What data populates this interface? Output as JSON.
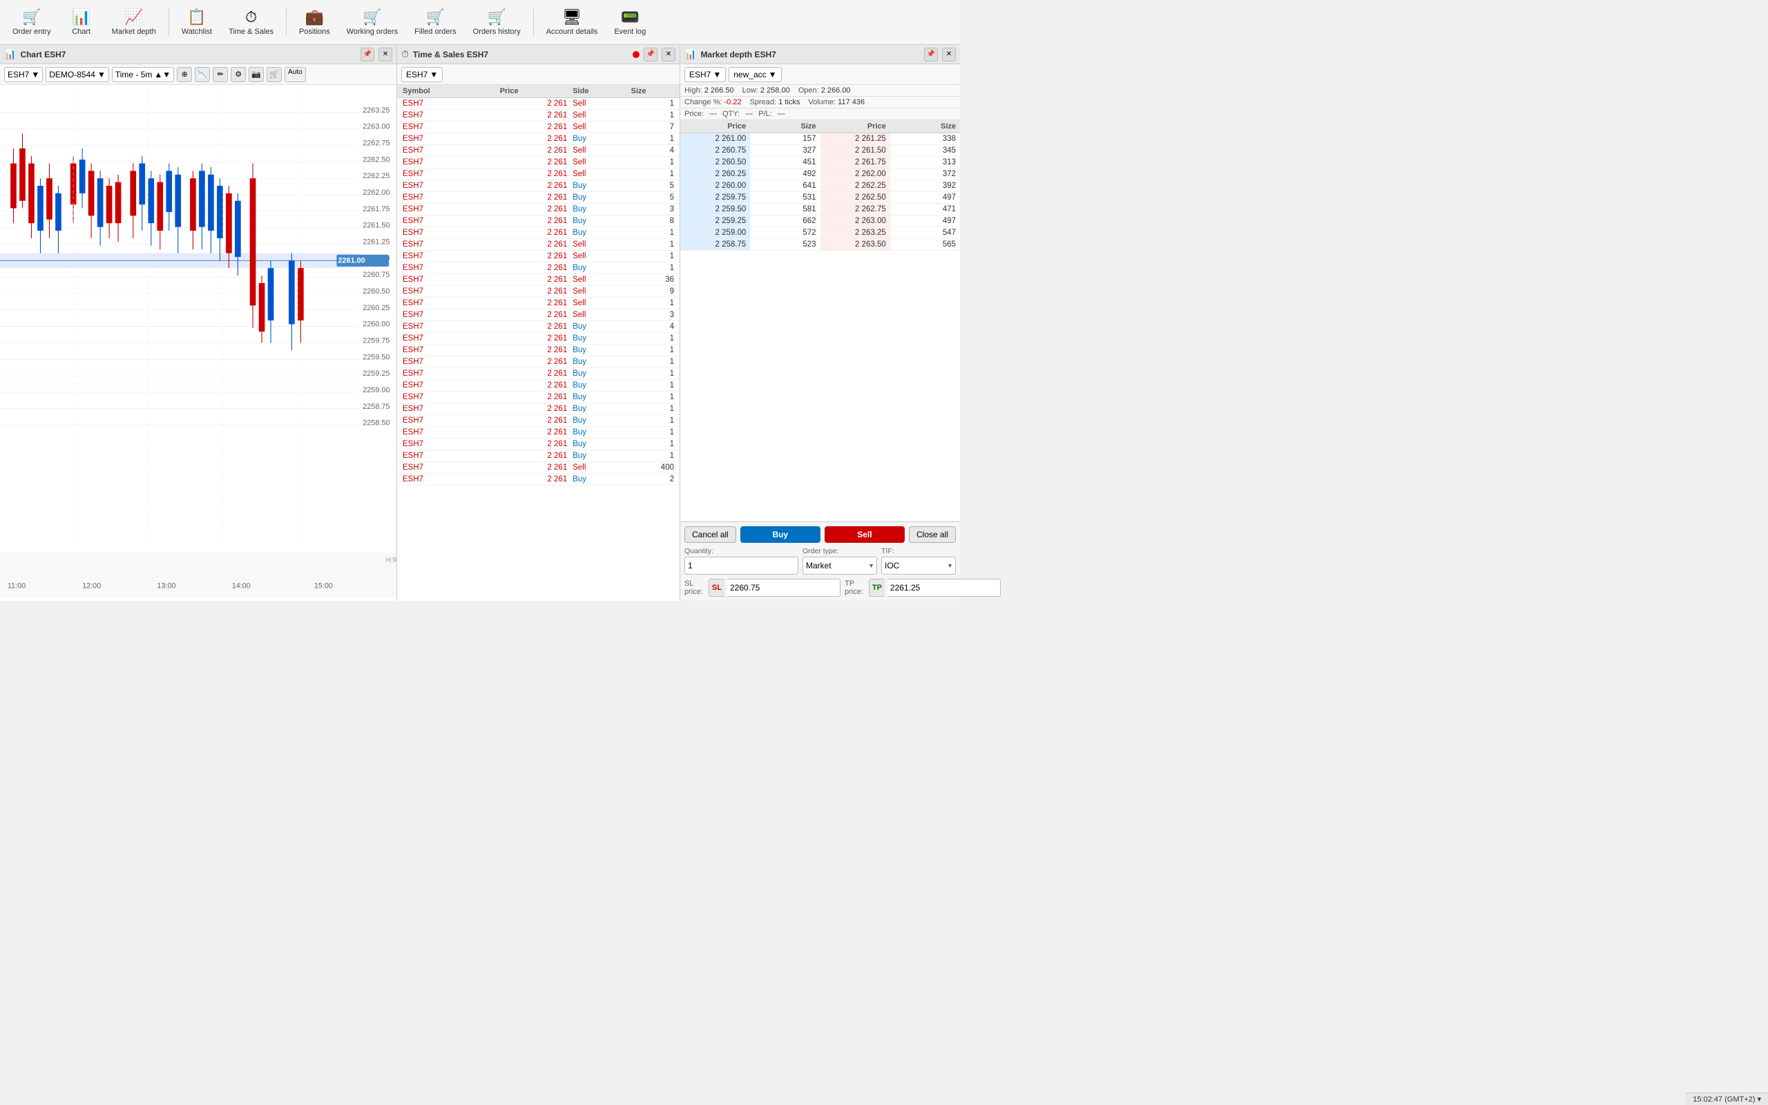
{
  "toolbar": {
    "items": [
      {
        "id": "order-entry",
        "icon": "🛒",
        "label": "Order entry"
      },
      {
        "id": "chart",
        "icon": "📊",
        "label": "Chart"
      },
      {
        "id": "market-depth",
        "icon": "📈",
        "label": "Market depth"
      },
      {
        "id": "watchlist",
        "icon": "📋",
        "label": "Watchlist"
      },
      {
        "id": "time-sales",
        "icon": "⏱",
        "label": "Time & Sales"
      },
      {
        "id": "positions",
        "icon": "💼",
        "label": "Positions"
      },
      {
        "id": "working-orders",
        "icon": "🛒",
        "label": "Working orders"
      },
      {
        "id": "filled-orders",
        "icon": "🛒",
        "label": "Filled orders"
      },
      {
        "id": "orders-history",
        "icon": "🛒",
        "label": "Orders history"
      },
      {
        "id": "account-details",
        "icon": "🖥",
        "label": "Account details"
      },
      {
        "id": "event-log",
        "icon": "📟",
        "label": "Event log"
      }
    ]
  },
  "chart_panel": {
    "header": "Chart ESH7",
    "symbol": "ESH7",
    "account": "DEMO-8544",
    "timeframe": "Time - 5m",
    "prices": {
      "high": "2 266.50",
      "low": "2 258.00",
      "open": "2 266.00",
      "change_pct": "-0.22",
      "spread": "1 ticks",
      "volume": "117 436"
    },
    "current_price": "2261.00",
    "time_labels": [
      "11:00",
      "12:00",
      "13:00",
      "14:00",
      "15:00"
    ],
    "price_labels": [
      "2263.25",
      "2263.00",
      "2262.75",
      "2262.50",
      "2262.25",
      "2262.00",
      "2261.75",
      "2261.50",
      "2261.25",
      "2261.00",
      "2260.75",
      "2260.50",
      "2260.25",
      "2260.00",
      "2259.75",
      "2259.50",
      "2259.25",
      "2259.00",
      "2258.75",
      "2258.50"
    ]
  },
  "ts_panel": {
    "header": "Time & Sales ESH7",
    "symbol": "ESH7",
    "columns": [
      "Symbol",
      "Price",
      "Side",
      "Size"
    ],
    "rows": [
      {
        "symbol": "ESH7",
        "price": "2 261",
        "side": "Sell",
        "size": "1"
      },
      {
        "symbol": "ESH7",
        "price": "2 261",
        "side": "Sell",
        "size": "1"
      },
      {
        "symbol": "ESH7",
        "price": "2 261",
        "side": "Sell",
        "size": "7"
      },
      {
        "symbol": "ESH7",
        "price": "2 261",
        "side": "Buy",
        "size": "1"
      },
      {
        "symbol": "ESH7",
        "price": "2 261",
        "side": "Sell",
        "size": "4"
      },
      {
        "symbol": "ESH7",
        "price": "2 261",
        "side": "Sell",
        "size": "1"
      },
      {
        "symbol": "ESH7",
        "price": "2 261",
        "side": "Sell",
        "size": "1"
      },
      {
        "symbol": "ESH7",
        "price": "2 261",
        "side": "Buy",
        "size": "5"
      },
      {
        "symbol": "ESH7",
        "price": "2 261",
        "side": "Buy",
        "size": "5"
      },
      {
        "symbol": "ESH7",
        "price": "2 261",
        "side": "Buy",
        "size": "3"
      },
      {
        "symbol": "ESH7",
        "price": "2 261",
        "side": "Buy",
        "size": "8"
      },
      {
        "symbol": "ESH7",
        "price": "2 261",
        "side": "Buy",
        "size": "1"
      },
      {
        "symbol": "ESH7",
        "price": "2 261",
        "side": "Sell",
        "size": "1"
      },
      {
        "symbol": "ESH7",
        "price": "2 261",
        "side": "Sell",
        "size": "1"
      },
      {
        "symbol": "ESH7",
        "price": "2 261",
        "side": "Buy",
        "size": "1"
      },
      {
        "symbol": "ESH7",
        "price": "2 261",
        "side": "Sell",
        "size": "36"
      },
      {
        "symbol": "ESH7",
        "price": "2 261",
        "side": "Sell",
        "size": "9"
      },
      {
        "symbol": "ESH7",
        "price": "2 261",
        "side": "Sell",
        "size": "1"
      },
      {
        "symbol": "ESH7",
        "price": "2 261",
        "side": "Sell",
        "size": "3"
      },
      {
        "symbol": "ESH7",
        "price": "2 261",
        "side": "Buy",
        "size": "4"
      },
      {
        "symbol": "ESH7",
        "price": "2 261",
        "side": "Buy",
        "size": "1"
      },
      {
        "symbol": "ESH7",
        "price": "2 261",
        "side": "Buy",
        "size": "1"
      },
      {
        "symbol": "ESH7",
        "price": "2 261",
        "side": "Buy",
        "size": "1"
      },
      {
        "symbol": "ESH7",
        "price": "2 261",
        "side": "Buy",
        "size": "1"
      },
      {
        "symbol": "ESH7",
        "price": "2 261",
        "side": "Buy",
        "size": "1"
      },
      {
        "symbol": "ESH7",
        "price": "2 261",
        "side": "Buy",
        "size": "1"
      },
      {
        "symbol": "ESH7",
        "price": "2 261",
        "side": "Buy",
        "size": "1"
      },
      {
        "symbol": "ESH7",
        "price": "2 261",
        "side": "Buy",
        "size": "1"
      },
      {
        "symbol": "ESH7",
        "price": "2 261",
        "side": "Buy",
        "size": "1"
      },
      {
        "symbol": "ESH7",
        "price": "2 261",
        "side": "Buy",
        "size": "1"
      },
      {
        "symbol": "ESH7",
        "price": "2 261",
        "side": "Buy",
        "size": "1"
      },
      {
        "symbol": "ESH7",
        "price": "2 261",
        "side": "Sell",
        "size": "400"
      },
      {
        "symbol": "ESH7",
        "price": "2 261",
        "side": "Buy",
        "size": "2"
      }
    ]
  },
  "md_panel": {
    "header": "Market depth ESH7",
    "symbol": "ESH7",
    "account": "new_acc",
    "high": "2 266.50",
    "low": "2 258.00",
    "open": "2 266.00",
    "change_pct": "-0.22",
    "spread": "1 ticks",
    "volume": "117 436",
    "price_label": "Price:",
    "price_val": "---",
    "qty_label": "QTY:",
    "qty_val": "---",
    "pl_label": "P/L:",
    "pl_val": "---",
    "columns": [
      "Price",
      "Size",
      "Price",
      "Size"
    ],
    "depth_rows": [
      {
        "bid_price": "2 261.00",
        "bid_size": "157",
        "ask_price": "2 261.25",
        "ask_size": "338"
      },
      {
        "bid_price": "2 260.75",
        "bid_size": "327",
        "ask_price": "2 261.50",
        "ask_size": "345"
      },
      {
        "bid_price": "2 260.50",
        "bid_size": "451",
        "ask_price": "2 261.75",
        "ask_size": "313"
      },
      {
        "bid_price": "2 260.25",
        "bid_size": "492",
        "ask_price": "2 262.00",
        "ask_size": "372"
      },
      {
        "bid_price": "2 260.00",
        "bid_size": "641",
        "ask_price": "2 262.25",
        "ask_size": "392"
      },
      {
        "bid_price": "2 259.75",
        "bid_size": "531",
        "ask_price": "2 262.50",
        "ask_size": "497"
      },
      {
        "bid_price": "2 259.50",
        "bid_size": "581",
        "ask_price": "2 262.75",
        "ask_size": "471"
      },
      {
        "bid_price": "2 259.25",
        "bid_size": "662",
        "ask_price": "2 263.00",
        "ask_size": "497"
      },
      {
        "bid_price": "2 259.00",
        "bid_size": "572",
        "ask_price": "2 263.25",
        "ask_size": "547"
      },
      {
        "bid_price": "2 258.75",
        "bid_size": "523",
        "ask_price": "2 263.50",
        "ask_size": "565"
      }
    ],
    "order_entry": {
      "cancel_all_label": "Cancel all",
      "buy_label": "Buy",
      "sell_label": "Sell",
      "close_all_label": "Close all",
      "quantity_label": "Quantity:",
      "quantity_val": "1",
      "order_type_label": "Order type:",
      "order_type_val": "Market",
      "tif_label": "TIF:",
      "tif_val": "IOC",
      "sl_price_label": "SL price:",
      "sl_prefix": "SL",
      "sl_val": "2260.75",
      "tp_price_label": "TP price:",
      "tp_prefix": "TP",
      "tp_val": "2261.25"
    }
  },
  "status_bar": {
    "time": "15:02:47 (GMT+2) ▾"
  }
}
